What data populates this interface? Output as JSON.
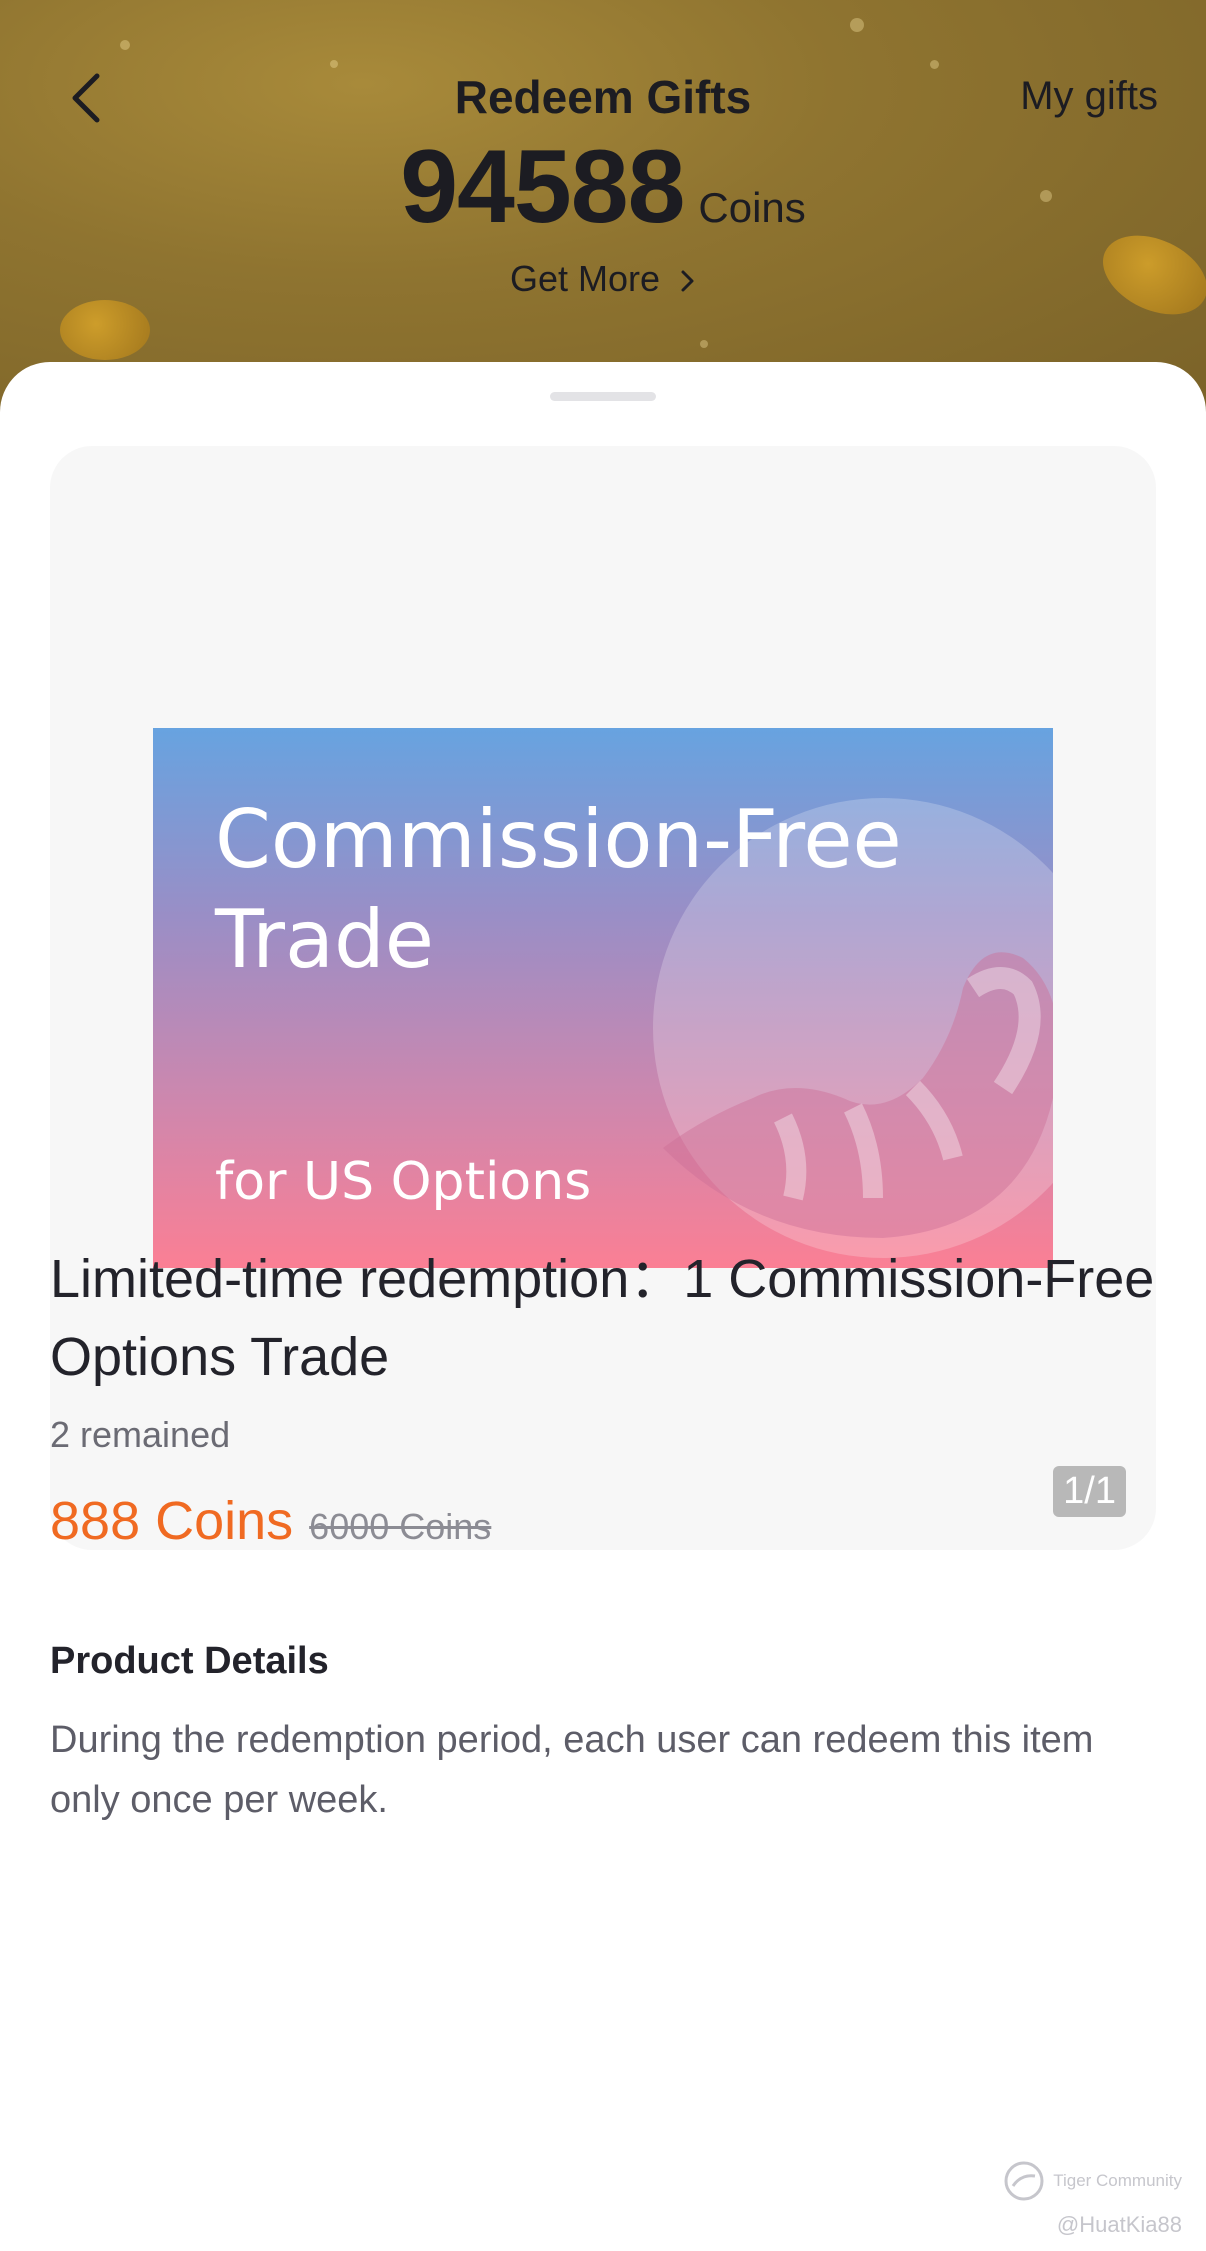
{
  "header": {
    "title": "Redeem Gifts",
    "my_gifts_label": "My gifts",
    "balance_value": "94588",
    "balance_unit": "Coins",
    "get_more_label": "Get More",
    "back_icon": "back-arrow-icon",
    "chevron_icon": "chevron-right-icon"
  },
  "gallery": {
    "banner_title": "Commission-Free\nTrade",
    "banner_subtitle": "for US Options",
    "page_indicator": "1/1"
  },
  "product": {
    "title": " Limited-time redemption：1 Commission-Free Options Trade",
    "remaining": "2 remained",
    "price": "888 Coins",
    "original_price": "6000 Coins"
  },
  "details": {
    "heading": "Product Details",
    "text": "During the redemption period, each user can redeem this item only once per week."
  },
  "watermark": {
    "brand": "Tiger Community",
    "user": "@HuatKia88"
  },
  "colors": {
    "accent": "#f06a22",
    "header_bg": "#8f7430",
    "text_primary": "#23232b"
  }
}
